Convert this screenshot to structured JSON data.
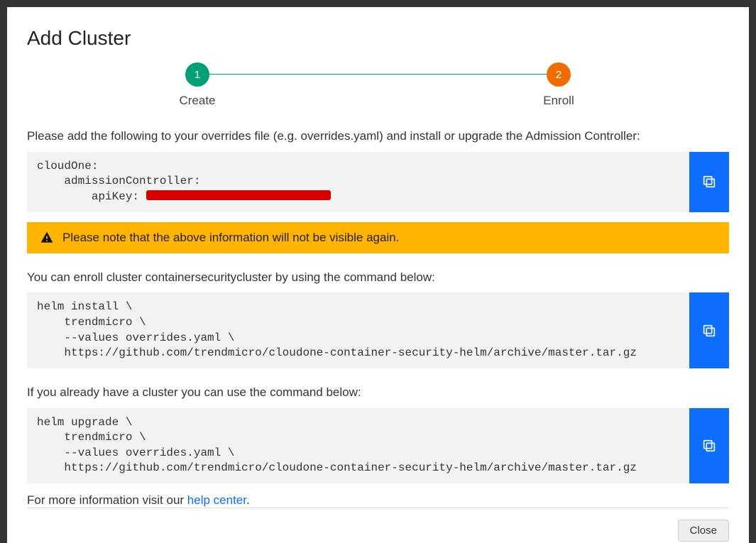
{
  "title": "Add Cluster",
  "stepper": {
    "step1": {
      "num": "1",
      "label": "Create"
    },
    "step2": {
      "num": "2",
      "label": "Enroll"
    }
  },
  "instructions": {
    "overrides": "Please add the following to your overrides file (e.g. overrides.yaml) and install or upgrade the Admission Controller:",
    "enroll": "You can enroll cluster containersecuritycluster by using the command below:",
    "upgrade": "If you already have a cluster you can use the command below:"
  },
  "code": {
    "overrides_prefix": "cloudOne:\n    admissionController:\n        apiKey: ",
    "install": "helm install \\\n    trendmicro \\\n    --values overrides.yaml \\\n    https://github.com/trendmicro/cloudone-container-security-helm/archive/master.tar.gz",
    "upgrade": "helm upgrade \\\n    trendmicro \\\n    --values overrides.yaml \\\n    https://github.com/trendmicro/cloudone-container-security-helm/archive/master.tar.gz"
  },
  "warning": "Please note that the above information will not be visible again.",
  "help": {
    "prefix": "For more information visit our ",
    "link": "help center",
    "suffix": "."
  },
  "buttons": {
    "close": "Close"
  }
}
